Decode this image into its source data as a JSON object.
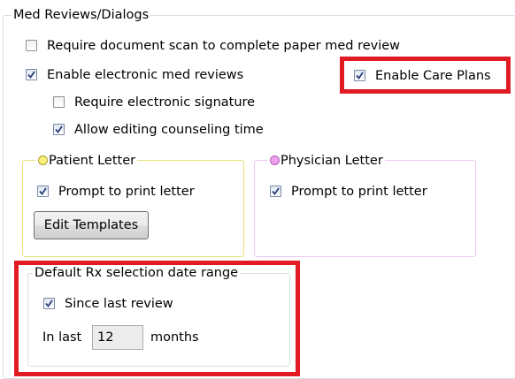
{
  "med_reviews": {
    "title": "Med Reviews/Dialogs",
    "require_scan": {
      "label": "Require document scan to complete paper med review",
      "checked": false
    },
    "enable_electronic": {
      "label": "Enable electronic med reviews",
      "checked": true
    },
    "enable_care_plans": {
      "label": "Enable Care Plans",
      "checked": true
    },
    "require_signature": {
      "label": "Require electronic signature",
      "checked": false
    },
    "allow_editing": {
      "label": "Allow editing counseling time",
      "checked": true
    }
  },
  "patient_letter": {
    "title": "Patient Letter",
    "dot_color": "#fbf07a",
    "prompt": {
      "label": "Prompt to print letter",
      "checked": true
    },
    "edit_templates_label": "Edit Templates"
  },
  "physician_letter": {
    "title": "Physician Letter",
    "dot_color": "#f0a0f0",
    "prompt": {
      "label": "Prompt to print letter",
      "checked": true
    }
  },
  "date_range": {
    "title": "Default Rx selection date range",
    "since_last": {
      "label": "Since last review",
      "checked": true
    },
    "in_last_label": "In last",
    "months_value": "12",
    "months_label": "months"
  },
  "colors": {
    "highlight": "#e01b24",
    "patient_border": "#e6e27a",
    "physician_border": "#f0c8f0"
  }
}
